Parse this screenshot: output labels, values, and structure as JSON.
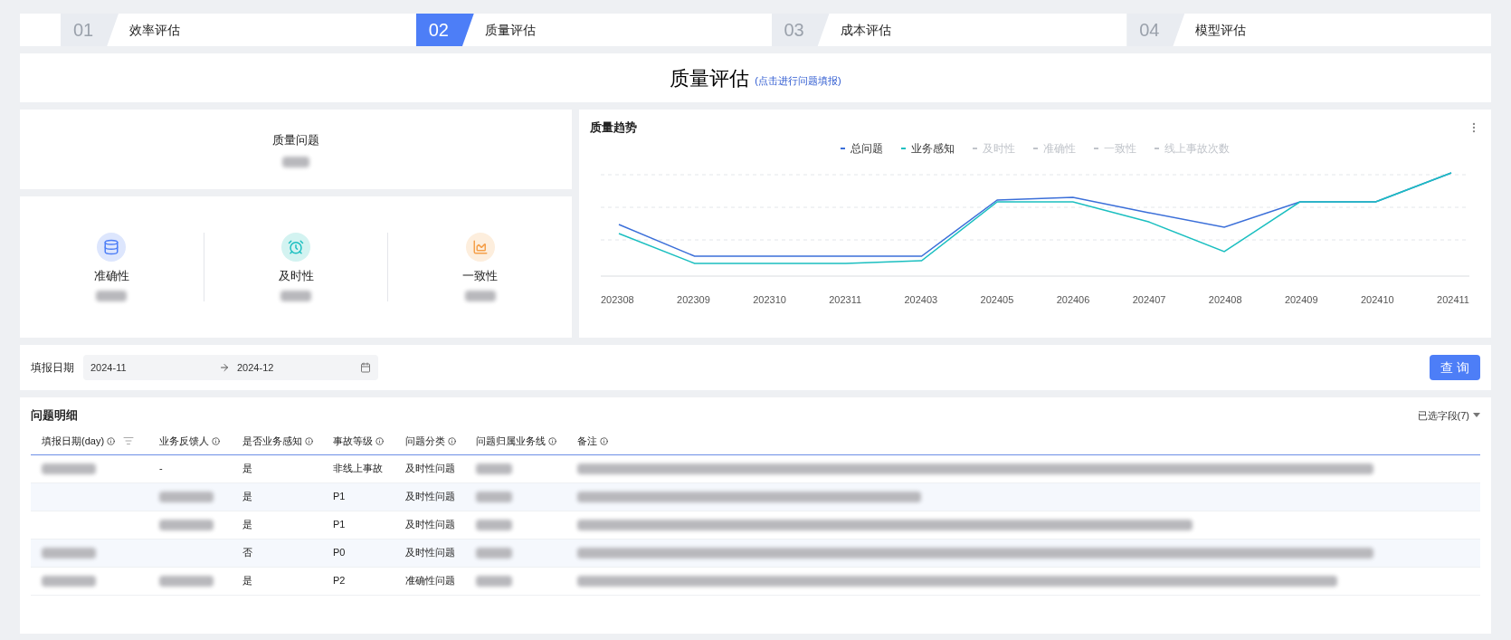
{
  "steps": [
    {
      "number": "01",
      "label": "效率评估",
      "selected": false
    },
    {
      "number": "02",
      "label": "质量评估",
      "selected": true
    },
    {
      "number": "03",
      "label": "成本评估",
      "selected": false
    },
    {
      "number": "04",
      "label": "模型评估",
      "selected": false
    }
  ],
  "header": {
    "title": "质量评估",
    "link": "(点击进行问题填报)"
  },
  "summary": {
    "label": "质量问题"
  },
  "metrics": [
    {
      "kind": "database",
      "label": "准确性"
    },
    {
      "kind": "clock",
      "label": "及时性"
    },
    {
      "kind": "chart",
      "label": "一致性"
    }
  ],
  "trend": {
    "title": "质量趋势",
    "legend": [
      {
        "label": "总问题",
        "color": "#3b6fd9",
        "active": true
      },
      {
        "label": "业务感知",
        "color": "#1bbfc0",
        "active": true
      },
      {
        "label": "及时性",
        "active": false
      },
      {
        "label": "准确性",
        "active": false
      },
      {
        "label": "一致性",
        "active": false
      },
      {
        "label": "线上事故次数",
        "active": false
      }
    ],
    "x_labels": [
      "202308",
      "202309",
      "202310",
      "202311",
      "202403",
      "202405",
      "202406",
      "202407",
      "202408",
      "202409",
      "202410",
      "202411"
    ]
  },
  "filter": {
    "label": "填报日期",
    "start": "2024-11",
    "end": "2024-12",
    "button": "查 询"
  },
  "table": {
    "title": "问题明细",
    "fields_selector": "已选字段(7)",
    "columns": [
      "填报日期(day)",
      "业务反馈人",
      "是否业务感知",
      "事故等级",
      "问题分类",
      "问题归属业务线",
      "备注"
    ],
    "rows": [
      {
        "cells": [
          {
            "kind": "redacted"
          },
          {
            "kind": "text",
            "text": "-"
          },
          {
            "kind": "text",
            "text": "是"
          },
          {
            "kind": "text",
            "text": "非线上事故"
          },
          {
            "kind": "text",
            "text": "及时性问题"
          },
          {
            "kind": "redacted"
          },
          {
            "kind": "redacted"
          }
        ]
      },
      {
        "cells": [
          {
            "kind": "empty"
          },
          {
            "kind": "redacted"
          },
          {
            "kind": "text",
            "text": "是"
          },
          {
            "kind": "text",
            "text": "P1"
          },
          {
            "kind": "text",
            "text": "及时性问题"
          },
          {
            "kind": "redacted"
          },
          {
            "kind": "redacted"
          }
        ]
      },
      {
        "cells": [
          {
            "kind": "empty"
          },
          {
            "kind": "redacted"
          },
          {
            "kind": "text",
            "text": "是"
          },
          {
            "kind": "text",
            "text": "P1"
          },
          {
            "kind": "text",
            "text": "及时性问题"
          },
          {
            "kind": "redacted"
          },
          {
            "kind": "redacted"
          }
        ]
      },
      {
        "cells": [
          {
            "kind": "redacted"
          },
          {
            "kind": "empty"
          },
          {
            "kind": "text",
            "text": "否"
          },
          {
            "kind": "text",
            "text": "P0"
          },
          {
            "kind": "text",
            "text": "及时性问题"
          },
          {
            "kind": "redacted"
          },
          {
            "kind": "redacted"
          }
        ]
      },
      {
        "cells": [
          {
            "kind": "redacted"
          },
          {
            "kind": "redacted"
          },
          {
            "kind": "text",
            "text": "是"
          },
          {
            "kind": "text",
            "text": "P2"
          },
          {
            "kind": "text",
            "text": "准确性问题"
          },
          {
            "kind": "redacted"
          },
          {
            "kind": "redacted"
          }
        ]
      }
    ]
  }
}
